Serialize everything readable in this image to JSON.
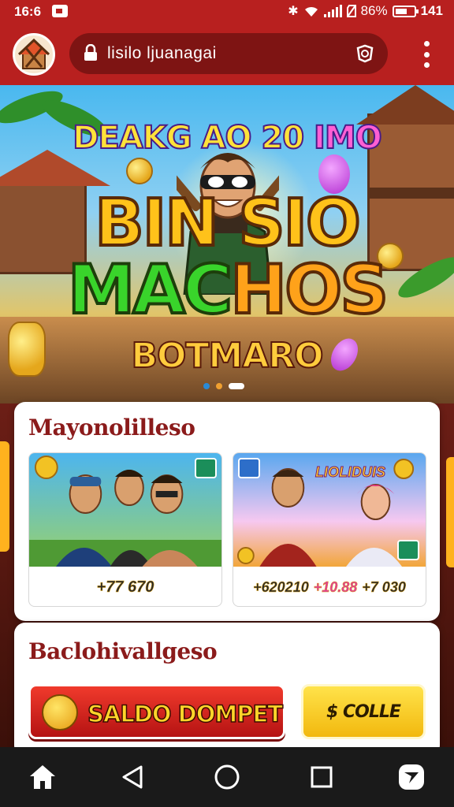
{
  "status_bar": {
    "time": "16:6",
    "battery": "86%",
    "clock_right": "141"
  },
  "browser": {
    "url": "lisilo ljuanagai"
  },
  "hero": {
    "top_line_a": "DEAKG AO 20 ",
    "top_line_b": "IMO",
    "title_line1": "BIN  SIO",
    "title_line2a": "MAC",
    "title_line2b": "HOS",
    "subtitle": "BOTMARO",
    "carousel_index": 2,
    "carousel_total": 3
  },
  "section1": {
    "title": "Mayonolilleso",
    "games": [
      {
        "stats": [
          "+77 670"
        ]
      },
      {
        "stats": [
          "+620210",
          "+10.88",
          "+7 030"
        ],
        "logo_text": "LIOLIDUIS"
      }
    ]
  },
  "section2": {
    "title": "Baclohivallgeso",
    "saldo_button": "SALDO DOMPET",
    "coin_button": "$ COLLE"
  },
  "colors": {
    "brand_red": "#b8201f",
    "title_red": "#8b1b1b",
    "coin_yellow": "#f2b80e"
  }
}
